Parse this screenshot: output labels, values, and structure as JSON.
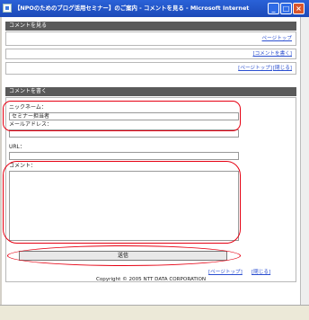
{
  "window": {
    "title": "【NPOのためのブログ活用セミナー】のご案内 - コメントを見る - Microsoft Internet ...",
    "min": "_",
    "max": "□",
    "close": "×"
  },
  "view_section": {
    "title": "コメントを見る",
    "top_link": "ページトップ",
    "write_link": "[コメントを書く]",
    "page_top_link": "[ページトップ]",
    "close_link": "[閉じる]"
  },
  "write_section": {
    "title": "コメントを書く",
    "nickname_label": "ニックネーム：",
    "nickname_value": "セミナー担当者",
    "email_label": "メールアドレス：",
    "email_value": "",
    "url_label": "URL：",
    "url_value": "",
    "comment_label": "コメント：",
    "comment_value": "",
    "submit_label": "送信",
    "page_top_link": "[ページトップ]",
    "close_link": "[閉じる]"
  },
  "footer": {
    "copyright": "Copyright © 2005 NTT DATA CORPORATION"
  },
  "colors": {
    "titlebar": "#1c49b8",
    "section_bar": "#5a5a5a",
    "highlight": "#e60012",
    "link": "#2b4fd0"
  }
}
